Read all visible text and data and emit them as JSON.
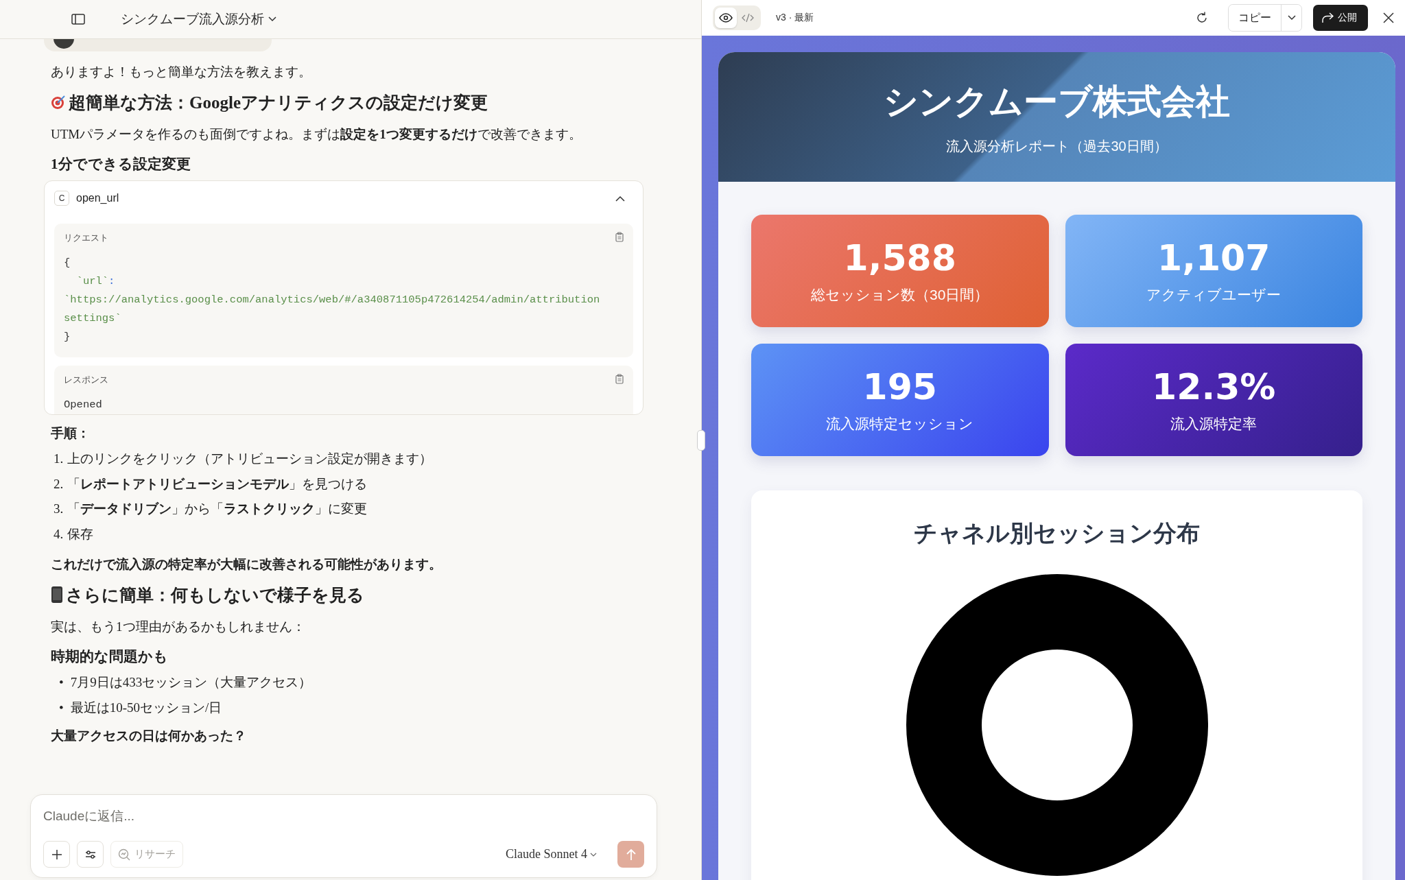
{
  "chat_header": {
    "title": "シンクムーブ流入源分析"
  },
  "messages": [
    {
      "kind": "para",
      "text": "ありますよ！もっと簡単な方法を教えます。"
    },
    {
      "kind": "h2",
      "text": "超簡単な方法：Googleアナリティクスの設定だけ変更"
    },
    {
      "kind": "para",
      "text": "UTMパラメータを作るのも面倒ですよね。まずは**設定を1つ変更するだけ**で改善できます。"
    },
    {
      "kind": "h3",
      "text": "1分でできる設定変更"
    },
    {
      "kind": "tool",
      "badge": "C",
      "name": "open_url",
      "expanded": true,
      "sections": [
        {
          "label": "リクエスト",
          "lines": [
            [
              {
                "kind": "punct",
                "text": "{"
              }
            ],
            [
              {
                "kind": "key",
                "text": "`url`"
              },
              {
                "kind": "colon",
                "text": ":"
              }
            ],
            [
              {
                "kind": "string",
                "text": "`https://analytics.google.com/analytics/web/#/a340871105p472614254/admin/attribution"
              }
            ],
            [
              {
                "kind": "string",
                "text": "settings`"
              }
            ],
            [
              {
                "kind": "punct",
                "text": "}"
              }
            ]
          ]
        },
        {
          "label": "レスポンス",
          "lines": [
            [
              {
                "kind": "punct",
                "text": "Opened"
              }
            ]
          ]
        }
      ]
    },
    {
      "kind": "h4",
      "text": "手順："
    },
    {
      "kind": "ol",
      "items": [
        {
          "marker": "1.",
          "text": "上のリンクをクリック（アトリビューション設定が開きます）"
        },
        {
          "marker": "2.",
          "text": "「**レポートアトリビューションモデル**」を見つける"
        },
        {
          "marker": "3.",
          "text": "「**データドリブン**」から「**ラストクリック**」に変更"
        },
        {
          "marker": "4.",
          "text": "保存"
        }
      ]
    },
    {
      "kind": "strong",
      "text": "これだけで流入源の特定率が大幅に改善される可能性があります。"
    },
    {
      "kind": "h2",
      "text": "さらに簡単：何もしないで様子を見る"
    },
    {
      "kind": "para",
      "text": "実は、もう1つ理由があるかもしれません："
    },
    {
      "kind": "h3",
      "text": "時期的な問題かも"
    },
    {
      "kind": "ul",
      "items": [
        {
          "marker": "•",
          "text": "7月9日は433セッション（大量アクセス）"
        },
        {
          "marker": "•",
          "text": "最近は10-50セッション/日"
        }
      ]
    },
    {
      "kind": "h4",
      "text": "大量アクセスの日は何かあった？"
    }
  ],
  "composer": {
    "placeholder": "Claudeに返信...",
    "research_label": "リサーチ",
    "model": "Claude Sonnet 4",
    "send_disabled": true
  },
  "preview_toolbar": {
    "view_toggle": [
      {
        "kind": "preview",
        "selected": true
      },
      {
        "kind": "code",
        "selected": false
      }
    ],
    "version": "v3 · 最新",
    "copy_label": "コピー",
    "publish_label": "公開"
  },
  "report": {
    "title": "シンクムーブ株式会社",
    "subtitle": "流入源分析レポート（過去30日間）",
    "stats": [
      {
        "value": "1,588",
        "label": "総セッション数（30日間）"
      },
      {
        "value": "1,107",
        "label": "アクティブユーザー"
      },
      {
        "value": "195",
        "label": "流入源特定セッション"
      },
      {
        "value": "12.3%",
        "label": "流入源特定率"
      }
    ],
    "chart_title": "チャネル別セッション分布"
  }
}
